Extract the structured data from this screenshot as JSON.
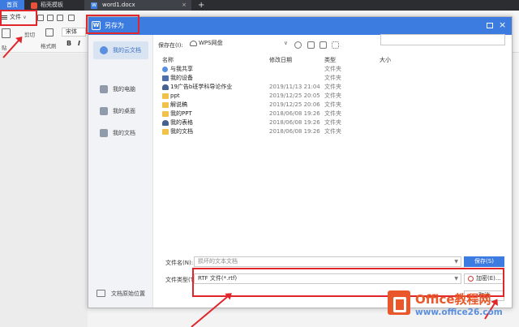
{
  "tabs": {
    "home": "首页",
    "template": "稻壳模板",
    "doc": "word1.docx",
    "close": "×",
    "add": "+"
  },
  "ribbon": {
    "file_menu": "文件",
    "cut": "剪切",
    "format_painter": "格式刷",
    "font": "宋体",
    "paste_frag": "贴",
    "bold": "B",
    "italic": "I"
  },
  "dialog": {
    "title": "另存为",
    "logo": "W",
    "close": "×",
    "sidebar": [
      "我的云文档",
      "我的电脑",
      "我的桌面",
      "我的文档"
    ],
    "origin_location": "文档原始位置",
    "save_in_label": "保存在(I):",
    "save_in_value": "WPS网盘",
    "columns": {
      "name": "名称",
      "date": "修改日期",
      "type": "类型",
      "size": "大小"
    },
    "files": [
      {
        "name": "与我共享",
        "date": "",
        "type": "文件夹",
        "icon": "share-icon"
      },
      {
        "name": "我的设备",
        "date": "",
        "type": "文件夹",
        "icon": "device-icon"
      },
      {
        "name": "19广告b班学科导论作业",
        "date": "2019/11/13 21:04",
        "type": "文件夹",
        "icon": "user-folder-icon"
      },
      {
        "name": "ppt",
        "date": "2019/12/25 20:05",
        "type": "文件夹",
        "icon": "folder-icon"
      },
      {
        "name": "解说稿",
        "date": "2019/12/25 20:06",
        "type": "文件夹",
        "icon": "folder-icon"
      },
      {
        "name": "我的PPT",
        "date": "2018/06/08 19:26",
        "type": "文件夹",
        "icon": "folder-icon"
      },
      {
        "name": "我的表格",
        "date": "2018/06/08 19:26",
        "type": "文件夹",
        "icon": "user-folder-icon"
      },
      {
        "name": "我的文档",
        "date": "2018/06/08 19:26",
        "type": "文件夹",
        "icon": "folder-icon"
      }
    ],
    "filename_label": "文件名(N):",
    "filename_value": "损坏的文本文档",
    "filetype_label": "文件类型(T):",
    "filetype_value": "RTF 文件(*.rtf)",
    "save": "保存(S)",
    "encrypt": "加密(E)...",
    "cancel": "取消"
  },
  "watermark": {
    "brand": "Office教程网",
    "url": "www.office26.com"
  },
  "colors": {
    "accent": "#3c7be0",
    "highlight": "#e0262b",
    "watermark": "#e8582a"
  }
}
